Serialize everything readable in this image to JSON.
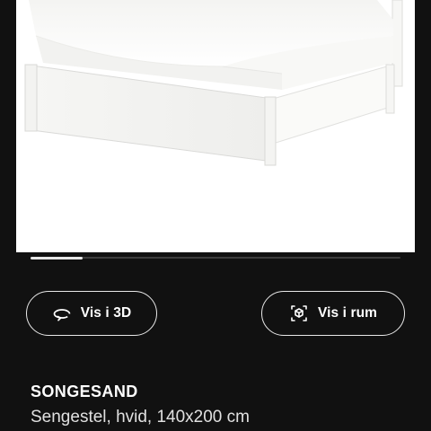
{
  "carousel": {
    "progress": 0.14
  },
  "actions": {
    "view_3d": {
      "label": "Vis i 3D",
      "icon": "rotate-360-icon"
    },
    "view_in_room": {
      "label": "Vis i rum",
      "icon": "ar-cube-icon"
    }
  },
  "product": {
    "name": "SONGESAND",
    "description": "Sengestel, hvid, 140x200 cm"
  },
  "colors": {
    "background": "#111111",
    "text": "#ffffff",
    "button_border": "#e8e8e8"
  }
}
